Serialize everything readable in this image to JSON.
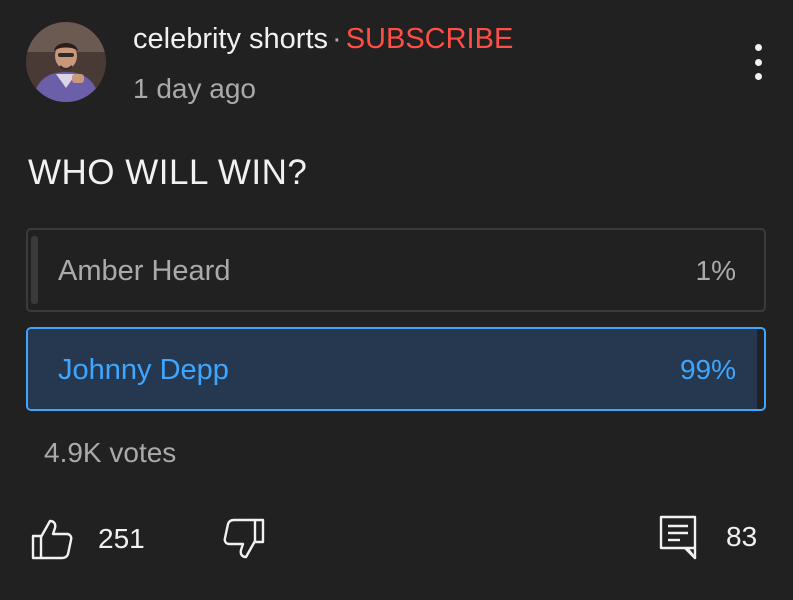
{
  "channel": {
    "name": "celebrity shorts",
    "separator": "·",
    "subscribe_label": "SUBSCRIBE",
    "posted": "1 day ago"
  },
  "poll": {
    "question": "WHO WILL WIN?",
    "options": [
      {
        "label": "Amber Heard",
        "percent_label": "1%",
        "percent": 1,
        "selected": false
      },
      {
        "label": "Johnny Depp",
        "percent_label": "99%",
        "percent": 99,
        "selected": true
      }
    ],
    "votes": "4.9K votes"
  },
  "actions": {
    "likes": "251",
    "comments": "83"
  },
  "colors": {
    "background": "#212121",
    "accent": "#3ea6ff",
    "subscribe": "#ff4e45",
    "secondary_text": "#aaaaaa"
  }
}
